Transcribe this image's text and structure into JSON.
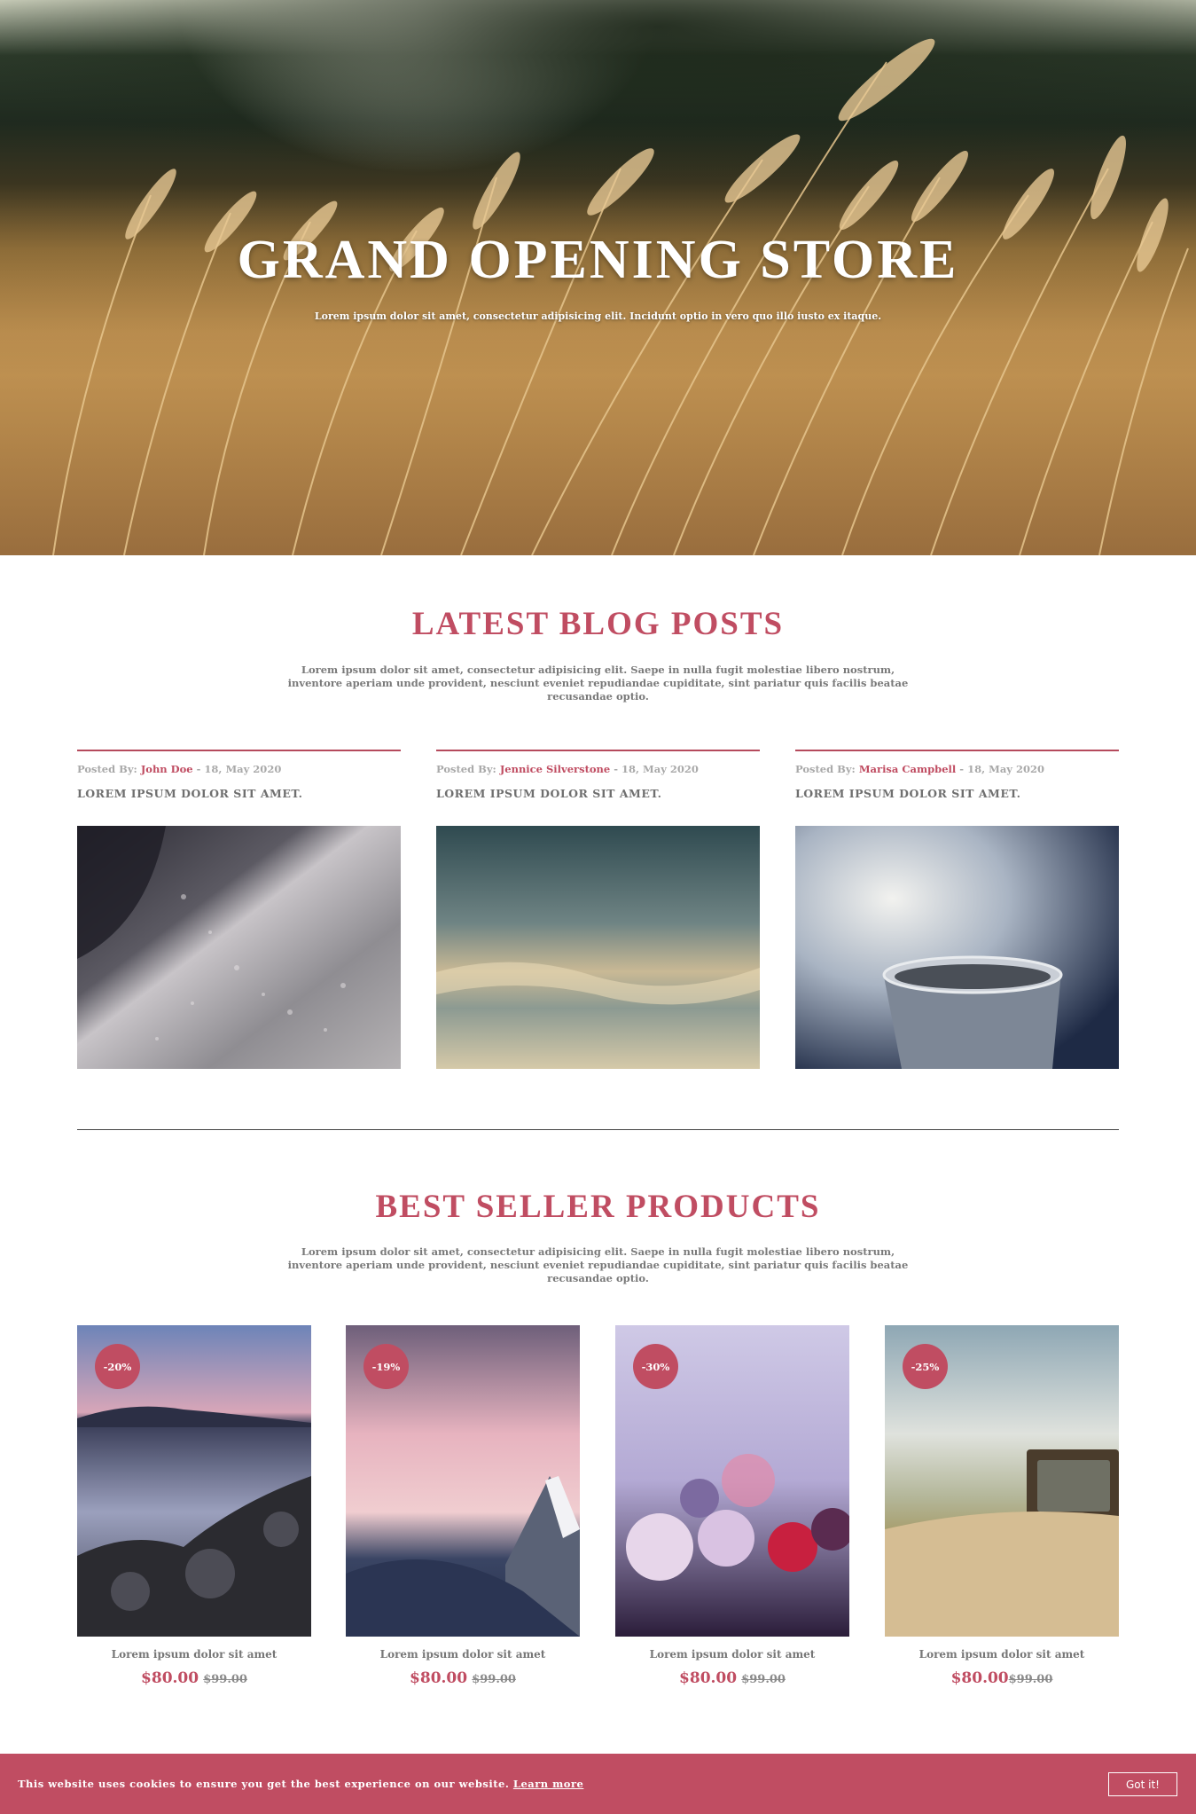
{
  "hero": {
    "title": "GRAND OPENING STORE",
    "subtitle": "Lorem ipsum dolor sit amet, consectetur adipisicing elit. Incidunt optio in vero quo illo iusto ex itaque."
  },
  "blog": {
    "title": "LATEST BLOG POSTS",
    "description": "Lorem ipsum dolor sit amet, consectetur adipisicing elit. Saepe in nulla fugit molestiae libero nostrum, inventore aperiam unde provident, nesciunt eveniet repudiandae cupiditate, sint pariatur quis facilis beatae recusandae optio.",
    "posts": [
      {
        "posted_by_label": "Posted By:",
        "author": "John Doe",
        "date": "- 18, May 2020",
        "heading": "LOREM IPSUM DOLOR SIT AMET."
      },
      {
        "posted_by_label": "Posted By:",
        "author": "Jennice Silverstone",
        "date": "- 18, May 2020",
        "heading": "LOREM IPSUM DOLOR SIT AMET."
      },
      {
        "posted_by_label": "Posted By:",
        "author": "Marisa Campbell",
        "date": "- 18, May 2020",
        "heading": "LOREM IPSUM DOLOR SIT AMET."
      }
    ]
  },
  "products": {
    "title": "BEST SELLER PRODUCTS",
    "description": "Lorem ipsum dolor sit amet, consectetur adipisicing elit. Saepe in nulla fugit molestiae libero nostrum, inventore aperiam unde provident, nesciunt eveniet repudiandae cupiditate, sint pariatur quis facilis beatae recusandae optio.",
    "items": [
      {
        "badge": "-20%",
        "name": "Lorem ipsum dolor sit amet",
        "price": "$80.00",
        "old_price": "$99.00"
      },
      {
        "badge": "-19%",
        "name": "Lorem ipsum dolor sit amet",
        "price": "$80.00",
        "old_price": "$99.00"
      },
      {
        "badge": "-30%",
        "name": "Lorem ipsum dolor sit amet",
        "price": "$80.00",
        "old_price": "$99.00"
      },
      {
        "badge": "-25%",
        "name": "Lorem ipsum dolor sit amet",
        "price": "$80.00",
        "old_price": "$99.00"
      }
    ]
  },
  "cookie": {
    "text": "This website uses cookies to ensure you get the best experience on our website.",
    "link": "Learn more",
    "button": "Got it!"
  },
  "colors": {
    "accent": "#c04d62",
    "text": "#6f6f6f"
  }
}
